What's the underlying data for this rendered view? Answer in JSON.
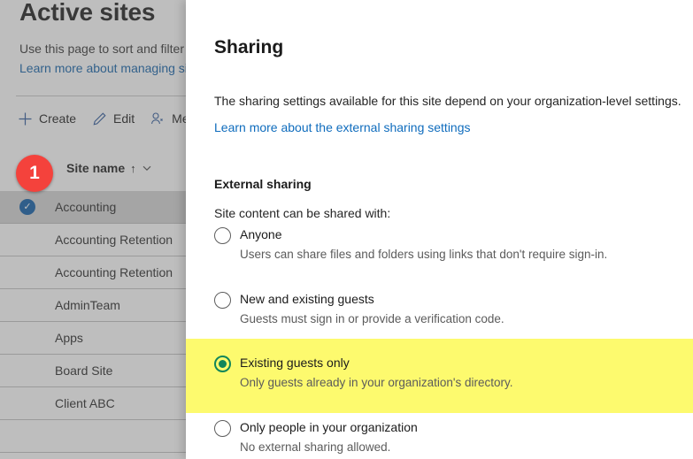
{
  "background_page": {
    "title": "Active sites",
    "description": "Use this page to sort and filter s",
    "learn_more_link": "Learn more about managing sit",
    "commands": [
      {
        "label": "Create",
        "icon": "plus-icon"
      },
      {
        "label": "Edit",
        "icon": "pencil-icon"
      },
      {
        "label": "Me",
        "icon": "members-icon"
      }
    ],
    "list": {
      "column_header": "Site name",
      "sort_arrow": "↑",
      "rows": [
        {
          "name": "Accounting",
          "selected": true
        },
        {
          "name": "Accounting Retention",
          "selected": false
        },
        {
          "name": "Accounting Retention",
          "selected": false
        },
        {
          "name": "AdminTeam",
          "selected": false
        },
        {
          "name": "Apps",
          "selected": false
        },
        {
          "name": "Board Site",
          "selected": false
        },
        {
          "name": "Client ABC",
          "selected": false
        }
      ]
    }
  },
  "step_badge": {
    "number": "1",
    "color": "#f4423c"
  },
  "panel": {
    "title": "Sharing",
    "description": "The sharing settings available for this site depend on your organization-level settings.",
    "learn_more_link": "Learn more about the external sharing settings",
    "section_label": "External sharing",
    "sub_label": "Site content can be shared with:",
    "highlight_color": "#fdfa6e",
    "selected_accent": "#11865a",
    "options": [
      {
        "label": "Anyone",
        "help": "Users can share files and folders using links that don't require sign-in.",
        "checked": false,
        "highlighted": false
      },
      {
        "label": "New and existing guests",
        "help": "Guests must sign in or provide a verification code.",
        "checked": false,
        "highlighted": false
      },
      {
        "label": "Existing guests only",
        "help": "Only guests already in your organization's directory.",
        "checked": true,
        "highlighted": true
      },
      {
        "label": "Only people in your organization",
        "help": "No external sharing allowed.",
        "checked": false,
        "highlighted": false
      }
    ]
  }
}
